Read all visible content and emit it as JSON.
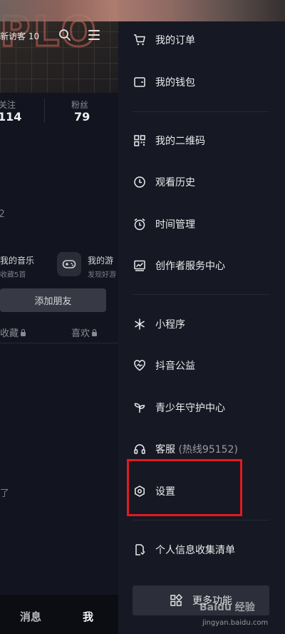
{
  "profile": {
    "visitor_text": "新访客 10",
    "stats": {
      "following_label": "关注",
      "following_value": "114",
      "fans_label": "粉丝",
      "fans_value": "79"
    },
    "partial_num": "2",
    "music_title": "我的音乐",
    "music_sub": "收藏5首",
    "game_title": "我的游",
    "game_sub": "发现好游",
    "add_friend_label": "添加朋友",
    "tabs": {
      "collect": "收藏",
      "like": "喜欢"
    },
    "partial_text": "了"
  },
  "bottom_nav": {
    "messages": "消息",
    "me": "我"
  },
  "drawer": {
    "items": [
      {
        "label": "我的订单",
        "icon": "cart-icon"
      },
      {
        "label": "我的钱包",
        "icon": "wallet-icon"
      },
      {
        "label": "我的二维码",
        "icon": "qrcode-icon"
      },
      {
        "label": "观看历史",
        "icon": "clock-icon"
      },
      {
        "label": "时间管理",
        "icon": "alarm-icon"
      },
      {
        "label": "创作者服务中心",
        "icon": "chart-icon"
      },
      {
        "label": "小程序",
        "icon": "asterisk-icon"
      },
      {
        "label": "抖音公益",
        "icon": "heart-icon"
      },
      {
        "label": "青少年守护中心",
        "icon": "sprout-icon"
      },
      {
        "label": "客服",
        "label_extra": "(热线95152)",
        "icon": "headset-icon"
      },
      {
        "label": "设置",
        "icon": "hexagon-settings-icon"
      },
      {
        "label": "个人信息收集清单",
        "icon": "document-icon"
      }
    ],
    "more_button": "更多功能",
    "highlight_color": "#e11a22"
  },
  "watermark": {
    "text": "Baidu 经验",
    "url": "jingyan.baidu.com"
  }
}
